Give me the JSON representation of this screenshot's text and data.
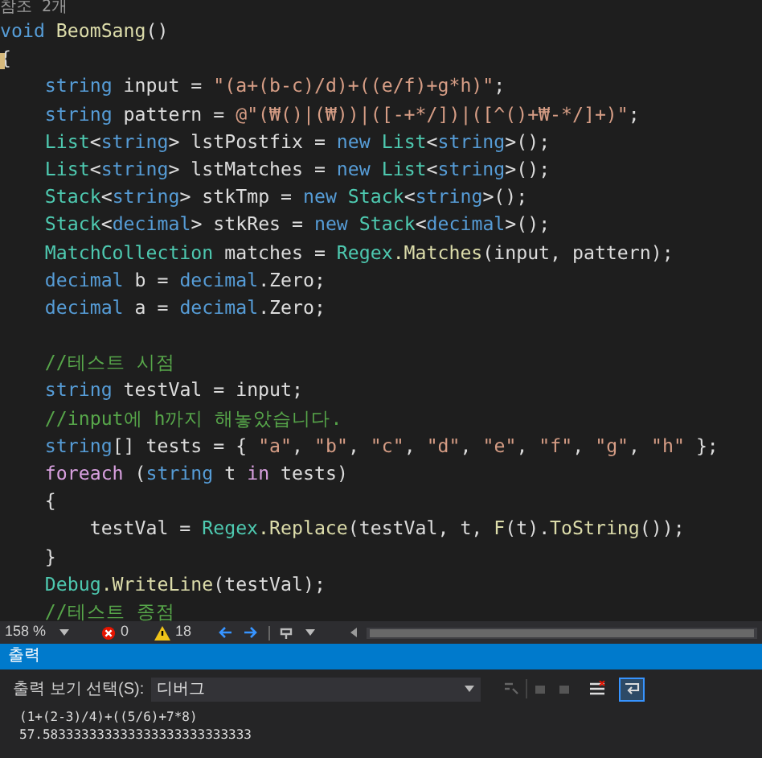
{
  "editor": {
    "codelens": "참조 2개",
    "lines": [
      {
        "kind": "code",
        "tokens": [
          {
            "kind": "keyword",
            "text": "void"
          },
          {
            "kind": "method",
            "text": " BeomSang"
          },
          {
            "kind": "plain",
            "text": "()"
          }
        ]
      },
      {
        "kind": "code",
        "tokens": [
          {
            "kind": "plain",
            "text": "{"
          }
        ]
      },
      {
        "kind": "code",
        "tokens": [
          {
            "kind": "keyword",
            "text": "    string"
          },
          {
            "kind": "plain",
            "text": " input = "
          },
          {
            "kind": "string",
            "text": "\"(a+(b-c)/d)+((e/f)+g*h)\""
          },
          {
            "kind": "plain",
            "text": ";"
          }
        ]
      },
      {
        "kind": "code",
        "tokens": [
          {
            "kind": "keyword",
            "text": "    string"
          },
          {
            "kind": "plain",
            "text": " pattern = "
          },
          {
            "kind": "string",
            "text": "@\"(₩()|(₩))|([-+*/])|([^()+₩-*/]+)\""
          },
          {
            "kind": "plain",
            "text": ";"
          }
        ]
      },
      {
        "kind": "code",
        "tokens": [
          {
            "kind": "type",
            "text": "    List"
          },
          {
            "kind": "plain",
            "text": "<"
          },
          {
            "kind": "keyword",
            "text": "string"
          },
          {
            "kind": "plain",
            "text": "> lstPostfix = "
          },
          {
            "kind": "keyword",
            "text": "new"
          },
          {
            "kind": "type",
            "text": " List"
          },
          {
            "kind": "plain",
            "text": "<"
          },
          {
            "kind": "keyword",
            "text": "string"
          },
          {
            "kind": "plain",
            "text": ">();"
          }
        ]
      },
      {
        "kind": "code",
        "tokens": [
          {
            "kind": "type",
            "text": "    List"
          },
          {
            "kind": "plain",
            "text": "<"
          },
          {
            "kind": "keyword",
            "text": "string"
          },
          {
            "kind": "plain",
            "text": "> lstMatches = "
          },
          {
            "kind": "keyword",
            "text": "new"
          },
          {
            "kind": "type",
            "text": " List"
          },
          {
            "kind": "plain",
            "text": "<"
          },
          {
            "kind": "keyword",
            "text": "string"
          },
          {
            "kind": "plain",
            "text": ">();"
          }
        ]
      },
      {
        "kind": "code",
        "tokens": [
          {
            "kind": "type",
            "text": "    Stack"
          },
          {
            "kind": "plain",
            "text": "<"
          },
          {
            "kind": "keyword",
            "text": "string"
          },
          {
            "kind": "plain",
            "text": "> stkTmp = "
          },
          {
            "kind": "keyword",
            "text": "new"
          },
          {
            "kind": "type",
            "text": " Stack"
          },
          {
            "kind": "plain",
            "text": "<"
          },
          {
            "kind": "keyword",
            "text": "string"
          },
          {
            "kind": "plain",
            "text": ">();"
          }
        ]
      },
      {
        "kind": "code",
        "tokens": [
          {
            "kind": "type",
            "text": "    Stack"
          },
          {
            "kind": "plain",
            "text": "<"
          },
          {
            "kind": "keyword",
            "text": "decimal"
          },
          {
            "kind": "plain",
            "text": "> stkRes = "
          },
          {
            "kind": "keyword",
            "text": "new"
          },
          {
            "kind": "type",
            "text": " Stack"
          },
          {
            "kind": "plain",
            "text": "<"
          },
          {
            "kind": "keyword",
            "text": "decimal"
          },
          {
            "kind": "plain",
            "text": ">();"
          }
        ]
      },
      {
        "kind": "code",
        "tokens": [
          {
            "kind": "type",
            "text": "    MatchCollection"
          },
          {
            "kind": "plain",
            "text": " matches = "
          },
          {
            "kind": "type",
            "text": "Regex"
          },
          {
            "kind": "method",
            "text": ".Matches"
          },
          {
            "kind": "plain",
            "text": "(input, pattern);"
          }
        ]
      },
      {
        "kind": "code",
        "tokens": [
          {
            "kind": "keyword",
            "text": "    decimal"
          },
          {
            "kind": "plain",
            "text": " b = "
          },
          {
            "kind": "keyword",
            "text": "decimal"
          },
          {
            "kind": "plain",
            "text": ".Zero;"
          }
        ]
      },
      {
        "kind": "code",
        "tokens": [
          {
            "kind": "keyword",
            "text": "    decimal"
          },
          {
            "kind": "plain",
            "text": " a = "
          },
          {
            "kind": "keyword",
            "text": "decimal"
          },
          {
            "kind": "plain",
            "text": ".Zero;"
          }
        ]
      },
      {
        "kind": "blank"
      },
      {
        "kind": "code",
        "tokens": [
          {
            "kind": "comment",
            "text": "    //테스트 시점"
          }
        ]
      },
      {
        "kind": "code",
        "tokens": [
          {
            "kind": "keyword",
            "text": "    string"
          },
          {
            "kind": "plain",
            "text": " testVal = input;"
          }
        ]
      },
      {
        "kind": "code",
        "tokens": [
          {
            "kind": "comment",
            "text": "    //input에 h까지 해놓았습니다."
          }
        ]
      },
      {
        "kind": "code",
        "tokens": [
          {
            "kind": "keyword",
            "text": "    string"
          },
          {
            "kind": "plain",
            "text": "[] tests = { "
          },
          {
            "kind": "string",
            "text": "\"a\""
          },
          {
            "kind": "plain",
            "text": ", "
          },
          {
            "kind": "string",
            "text": "\"b\""
          },
          {
            "kind": "plain",
            "text": ", "
          },
          {
            "kind": "string",
            "text": "\"c\""
          },
          {
            "kind": "plain",
            "text": ", "
          },
          {
            "kind": "string",
            "text": "\"d\""
          },
          {
            "kind": "plain",
            "text": ", "
          },
          {
            "kind": "string",
            "text": "\"e\""
          },
          {
            "kind": "plain",
            "text": ", "
          },
          {
            "kind": "string",
            "text": "\"f\""
          },
          {
            "kind": "plain",
            "text": ", "
          },
          {
            "kind": "string",
            "text": "\"g\""
          },
          {
            "kind": "plain",
            "text": ", "
          },
          {
            "kind": "string",
            "text": "\"h\""
          },
          {
            "kind": "plain",
            "text": " };"
          }
        ]
      },
      {
        "kind": "code",
        "tokens": [
          {
            "kind": "control",
            "text": "    foreach"
          },
          {
            "kind": "plain",
            "text": " ("
          },
          {
            "kind": "keyword",
            "text": "string"
          },
          {
            "kind": "plain",
            "text": " t "
          },
          {
            "kind": "control",
            "text": "in"
          },
          {
            "kind": "plain",
            "text": " tests)"
          }
        ]
      },
      {
        "kind": "code",
        "tokens": [
          {
            "kind": "plain",
            "text": "    {"
          }
        ]
      },
      {
        "kind": "code",
        "tokens": [
          {
            "kind": "plain",
            "text": "        testVal = "
          },
          {
            "kind": "type",
            "text": "Regex"
          },
          {
            "kind": "method",
            "text": ".Replace"
          },
          {
            "kind": "plain",
            "text": "(testVal, t, "
          },
          {
            "kind": "method",
            "text": "F"
          },
          {
            "kind": "plain",
            "text": "(t)."
          },
          {
            "kind": "method",
            "text": "ToString"
          },
          {
            "kind": "plain",
            "text": "());"
          }
        ]
      },
      {
        "kind": "code",
        "tokens": [
          {
            "kind": "plain",
            "text": "    }"
          }
        ]
      },
      {
        "kind": "code",
        "tokens": [
          {
            "kind": "type",
            "text": "    Debug"
          },
          {
            "kind": "method",
            "text": ".WriteLine"
          },
          {
            "kind": "plain",
            "text": "(testVal);"
          }
        ]
      },
      {
        "kind": "code",
        "tokens": [
          {
            "kind": "comment",
            "text": "    //테스트 종점"
          }
        ]
      }
    ]
  },
  "status_bar": {
    "zoom": "158 %",
    "errors": "0",
    "warnings": "18"
  },
  "output_panel": {
    "title": "출력",
    "source_label": "출력 보기 선택(S):",
    "source": "디버그",
    "lines": [
      "(1+(2-3)/4)+((5/6)+7*8)",
      "57.583333333333333333333333333"
    ]
  }
}
